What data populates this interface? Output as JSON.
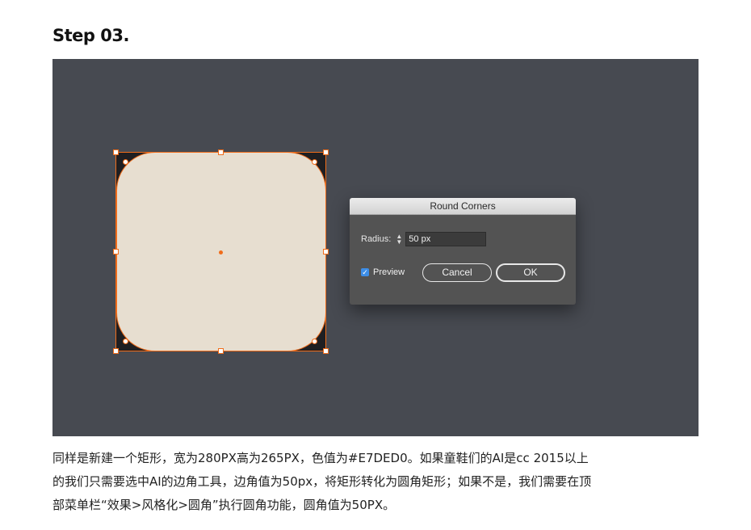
{
  "heading": "Step 03.",
  "dialog": {
    "title": "Round Corners",
    "radius_label": "Radius:",
    "radius_value": "50 px",
    "stepper_icon": "up-down-stepper",
    "preview_label": "Preview",
    "preview_checked": true,
    "cancel_label": "Cancel",
    "ok_label": "OK"
  },
  "shape": {
    "fill_color": "#e7ded0",
    "selection_color": "#f06c1a",
    "canvas_color": "#474a51"
  },
  "description": {
    "line1": " 同样是新建一个矩形，宽为280PX高为265PX，色值为#E7DED0。如果童鞋们的AI是cc 2015以上",
    "line2": "的我们只需要选中AI的边角工具，边角值为50px，将矩形转化为圆角矩形；如果不是，我们需要在顶",
    "line3": "部菜单栏“效果>风格化>圆角”执行圆角功能，圆角值为50PX。"
  }
}
